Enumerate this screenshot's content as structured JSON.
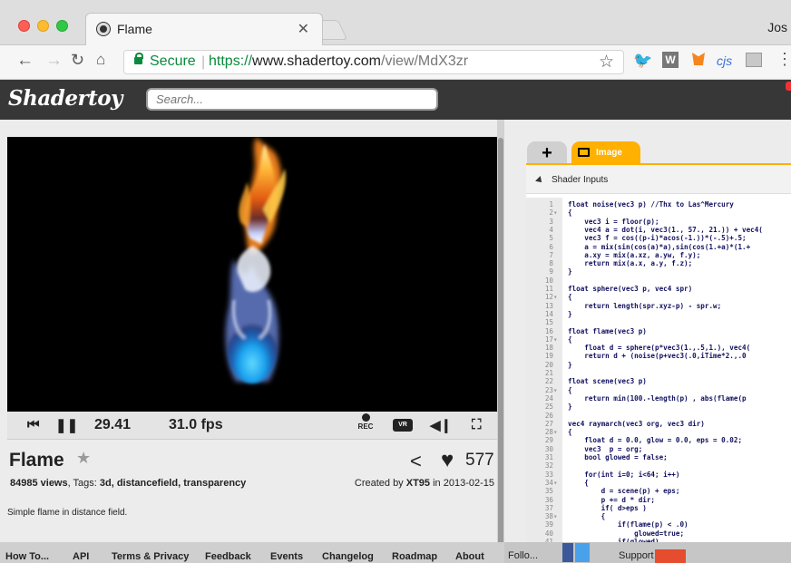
{
  "browser": {
    "tab_title": "Flame",
    "profile_name": "Jos",
    "secure_label": "Secure",
    "url_scheme": "https://",
    "url_host": "www.shadertoy.com",
    "url_path": "/view/MdX3zr",
    "extensions": [
      "twitter-icon",
      "w-icon",
      "metamask-icon",
      "cjs",
      "extension-icon",
      "menu-icon"
    ],
    "ext_cjs_label": "cjs",
    "ext_w_label": "W"
  },
  "site": {
    "logo": "Shadertoy",
    "search_placeholder": "Search..."
  },
  "player": {
    "time": "29.41",
    "fps": "31.0 fps",
    "rec_label": "REC",
    "vr_label": "VR"
  },
  "shader": {
    "title": "Flame",
    "likes": "577",
    "views": "84985 views",
    "tags_prefix": ", Tags: ",
    "tags": "3d, distancefield, transparency",
    "created_prefix": "Created by ",
    "author": "XT95",
    "created_suffix": " in 2013-02-15",
    "description": "Simple flame in distance field."
  },
  "footer": {
    "items": [
      "How To...",
      "API",
      "Terms & Privacy",
      "Feedback",
      "Events",
      "Changelog",
      "Roadmap",
      "About"
    ],
    "follow": "Follo...",
    "support": "Support us"
  },
  "editor": {
    "tab_add": "+",
    "tab_image": "Image",
    "inputs_label": "Shader Inputs",
    "lines": [
      {
        "n": "1",
        "f": "",
        "t": "float noise(vec3 p) //Thx to Las^Mercury"
      },
      {
        "n": "2",
        "f": "▾",
        "t": "{"
      },
      {
        "n": "3",
        "f": "",
        "t": "    vec3 i = floor(p);"
      },
      {
        "n": "4",
        "f": "",
        "t": "    vec4 a = dot(i, vec3(1., 57., 21.)) + vec4("
      },
      {
        "n": "5",
        "f": "",
        "t": "    vec3 f = cos((p-i)*acos(-1.))*(-.5)+.5;"
      },
      {
        "n": "6",
        "f": "",
        "t": "    a = mix(sin(cos(a)*a),sin(cos(1.+a)*(1.+"
      },
      {
        "n": "7",
        "f": "",
        "t": "    a.xy = mix(a.xz, a.yw, f.y);"
      },
      {
        "n": "8",
        "f": "",
        "t": "    return mix(a.x, a.y, f.z);"
      },
      {
        "n": "9",
        "f": "",
        "t": "}"
      },
      {
        "n": "10",
        "f": "",
        "t": ""
      },
      {
        "n": "11",
        "f": "",
        "t": "float sphere(vec3 p, vec4 spr)"
      },
      {
        "n": "12",
        "f": "▾",
        "t": "{"
      },
      {
        "n": "13",
        "f": "",
        "t": "    return length(spr.xyz-p) - spr.w;"
      },
      {
        "n": "14",
        "f": "",
        "t": "}"
      },
      {
        "n": "15",
        "f": "",
        "t": ""
      },
      {
        "n": "16",
        "f": "",
        "t": "float flame(vec3 p)"
      },
      {
        "n": "17",
        "f": "▾",
        "t": "{"
      },
      {
        "n": "18",
        "f": "",
        "t": "    float d = sphere(p*vec3(1.,.5,1.), vec4("
      },
      {
        "n": "19",
        "f": "",
        "t": "    return d + (noise(p+vec3(.0,iTime*2.,.0"
      },
      {
        "n": "20",
        "f": "",
        "t": "}"
      },
      {
        "n": "21",
        "f": "",
        "t": ""
      },
      {
        "n": "22",
        "f": "",
        "t": "float scene(vec3 p)"
      },
      {
        "n": "23",
        "f": "▾",
        "t": "{"
      },
      {
        "n": "24",
        "f": "",
        "t": "    return min(100.-length(p) , abs(flame(p"
      },
      {
        "n": "25",
        "f": "",
        "t": "}"
      },
      {
        "n": "26",
        "f": "",
        "t": ""
      },
      {
        "n": "27",
        "f": "",
        "t": "vec4 raymarch(vec3 org, vec3 dir)"
      },
      {
        "n": "28",
        "f": "▾",
        "t": "{"
      },
      {
        "n": "29",
        "f": "",
        "t": "    float d = 0.0, glow = 0.0, eps = 0.02;"
      },
      {
        "n": "30",
        "f": "",
        "t": "    vec3  p = org;"
      },
      {
        "n": "31",
        "f": "",
        "t": "    bool glowed = false;"
      },
      {
        "n": "32",
        "f": "",
        "t": ""
      },
      {
        "n": "33",
        "f": "",
        "t": "    for(int i=0; i<64; i++)"
      },
      {
        "n": "34",
        "f": "▾",
        "t": "    {"
      },
      {
        "n": "35",
        "f": "",
        "t": "        d = scene(p) + eps;"
      },
      {
        "n": "36",
        "f": "",
        "t": "        p += d * dir;"
      },
      {
        "n": "37",
        "f": "",
        "t": "        if( d>eps )"
      },
      {
        "n": "38",
        "f": "▾",
        "t": "        {"
      },
      {
        "n": "39",
        "f": "",
        "t": "            if(flame(p) < .0)"
      },
      {
        "n": "40",
        "f": "",
        "t": "                glowed=true;"
      },
      {
        "n": "41",
        "f": "",
        "t": "            if(glowed)"
      }
    ]
  },
  "colors": {
    "accent": "#ffb000",
    "header_bg": "#373737",
    "secure_green": "#0a8a3c"
  }
}
